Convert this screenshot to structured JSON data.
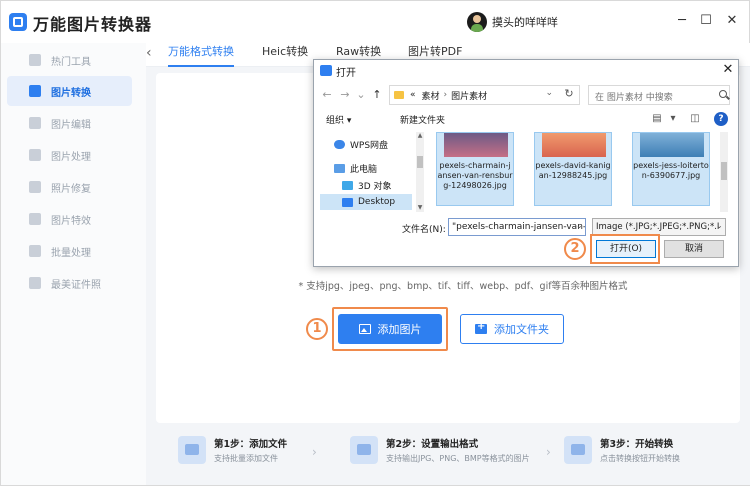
{
  "app": {
    "title": "万能图片转换器",
    "username": "摸头的咩咩咩",
    "controls": {
      "minimize": "─",
      "maximize": "☐",
      "close": "✕"
    }
  },
  "sidebar": {
    "items": [
      {
        "label": "热门工具",
        "active": false
      },
      {
        "label": "图片转换",
        "active": true
      },
      {
        "label": "图片编辑",
        "active": false
      },
      {
        "label": "图片处理",
        "active": false
      },
      {
        "label": "照片修复",
        "active": false
      },
      {
        "label": "图片特效",
        "active": false
      },
      {
        "label": "批量处理",
        "active": false
      },
      {
        "label": "最美证件照",
        "active": false
      }
    ]
  },
  "tabs": {
    "back": "‹",
    "items": [
      {
        "label": "万能格式转换",
        "active": true
      },
      {
        "label": "Heic转换",
        "active": false
      },
      {
        "label": "Raw转换",
        "active": false
      },
      {
        "label": "图片转PDF",
        "active": false
      }
    ]
  },
  "main": {
    "hint": "* 支持jpg、jpeg、png、bmp、tif、tiff、webp、pdf、gif等百余种图片格式",
    "add_image": "添加图片",
    "add_folder": "添加文件夹",
    "annotation_1": "1",
    "annotation_2": "2"
  },
  "steps": [
    {
      "title": "第1步：添加文件",
      "sub": "支持批量添加文件"
    },
    {
      "title": "第2步：设置输出格式",
      "sub": "支持输出JPG、PNG、BMP等格式的图片"
    },
    {
      "title": "第3步：开始转换",
      "sub": "点击转换按钮开始转换"
    }
  ],
  "dialog": {
    "title": "打开",
    "close": "✕",
    "nav": {
      "back": "←",
      "forward": "→",
      "dropdown": "⌄",
      "up": "↑",
      "refresh": "↻"
    },
    "breadcrumb": {
      "prefix": "«",
      "folder1": "素材",
      "separator": "›",
      "folder2": "图片素材"
    },
    "search_placeholder": "在 图片素材 中搜索",
    "toolbar": {
      "organize": "组织 ▾",
      "new_folder": "新建文件夹",
      "help": "?"
    },
    "nav_pane": [
      {
        "label": "WPS网盘",
        "selected": false,
        "color": "#3b86e8"
      },
      {
        "label": "此电脑",
        "selected": false,
        "color": "#5a9de6"
      },
      {
        "label": "3D 对象",
        "selected": false,
        "color": "#3fa8e8"
      },
      {
        "label": "Desktop",
        "selected": true,
        "color": "#2e7ff0"
      }
    ],
    "files": [
      {
        "name": "pexels-charmain-jansen-van-rensburg-12498026.jpg",
        "thumb_top": "#6d5a86",
        "thumb_bottom": "#c56f86"
      },
      {
        "name": "pexels-david-kanigan-12988245.jpg",
        "thumb_top": "#f09a6d",
        "thumb_bottom": "#d9644f"
      },
      {
        "name": "pexels-jess-loiterton-6390677.jpg",
        "thumb_top": "#7fb0d8",
        "thumb_bottom": "#3e7fb5"
      }
    ],
    "filename_label": "文件名(N):",
    "filename_value": "\"pexels-charmain-jansen-van-r",
    "filter_value": "Image (*.JPG;*.JPEG;*.PNG;*.I",
    "open": "打开(O)",
    "cancel": "取消"
  },
  "colors": {
    "accent": "#2e7ff0",
    "annotation": "#f08a4b"
  }
}
